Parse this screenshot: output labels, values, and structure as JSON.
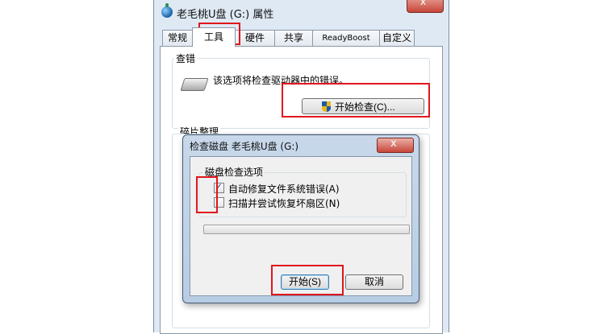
{
  "properties_window": {
    "title": "老毛桃U盘 (G:) 属性",
    "close_label": "x",
    "tabs": [
      "常规",
      "工具",
      "硬件",
      "共享",
      "ReadyBoost",
      "自定义"
    ],
    "active_tab": "工具",
    "error_check": {
      "group_title": "查错",
      "description": "该选项将检查驱动器中的错误。",
      "button_label": "开始检查(C)..."
    },
    "defrag": {
      "group_title": "碎片整理"
    }
  },
  "check_disk_dialog": {
    "title": "检查磁盘 老毛桃U盘 (G:)",
    "close_label": "x",
    "options_group_title": "磁盘检查选项",
    "options": [
      {
        "label": "自动修复文件系统错误(A)",
        "checked": true
      },
      {
        "label": "扫描并尝试恢复坏扇区(N)",
        "checked": false
      }
    ],
    "progress": 0,
    "start_button": "开始(S)",
    "cancel_button": "取消"
  },
  "colors": {
    "highlight": "#e0161c"
  }
}
